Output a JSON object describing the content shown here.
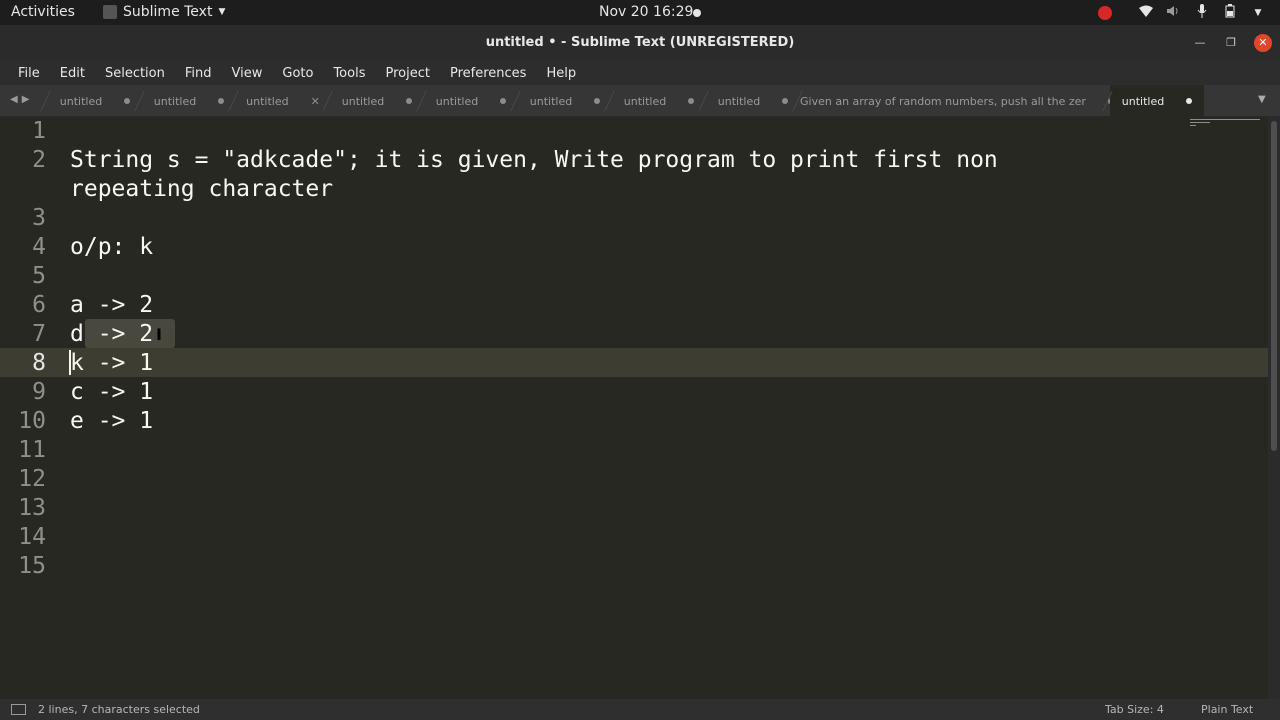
{
  "topbar": {
    "activities": "Activities",
    "app_name": "Sublime Text",
    "clock": "Nov 20  16:29",
    "tray_icons": [
      "record-icon",
      "wifi-icon",
      "volume-icon",
      "mic-icon",
      "battery-icon",
      "menu-caret-icon"
    ]
  },
  "window": {
    "title": "untitled • - Sublime Text (UNREGISTERED)"
  },
  "menu": [
    "File",
    "Edit",
    "Selection",
    "Find",
    "View",
    "Goto",
    "Tools",
    "Project",
    "Preferences",
    "Help"
  ],
  "tabs": [
    {
      "label": "untitled",
      "marker": "dot",
      "active": false
    },
    {
      "label": "untitled",
      "marker": "dot",
      "active": false
    },
    {
      "label": "untitled",
      "marker": "close",
      "active": false
    },
    {
      "label": "untitled",
      "marker": "dot",
      "active": false
    },
    {
      "label": "untitled",
      "marker": "dot",
      "active": false
    },
    {
      "label": "untitled",
      "marker": "dot",
      "active": false
    },
    {
      "label": "untitled",
      "marker": "dot",
      "active": false
    },
    {
      "label": "untitled",
      "marker": "dot",
      "active": false
    },
    {
      "label": "Given an array of random numbers, push all the zer",
      "marker": "dot",
      "active": false
    },
    {
      "label": "untitled",
      "marker": "dot",
      "active": true
    }
  ],
  "editor": {
    "line_numbers": [
      "1",
      "2",
      "",
      "3",
      "4",
      "5",
      "6",
      "7",
      "8",
      "9",
      "10",
      "11",
      "12",
      "13",
      "14",
      "15"
    ],
    "current_line": "8",
    "lines": [
      "",
      "String s = \"adkcade\"; it is given, Write program to print first non",
      "repeating character",
      "",
      "o/p: k",
      "",
      "a -> 2",
      "d -> 2",
      "k -> 1",
      "c -> 1",
      "e -> 1",
      "",
      "",
      "",
      "",
      ""
    ]
  },
  "statusbar": {
    "selection_info": "2 lines, 7 characters selected",
    "tab_size": "Tab Size: 4",
    "syntax": "Plain Text"
  },
  "colors": {
    "editor_bg": "#272822",
    "text": "#f8f8f2",
    "gutter_text": "#90908a",
    "close_button": "#e0462a",
    "record": "#d72828"
  }
}
